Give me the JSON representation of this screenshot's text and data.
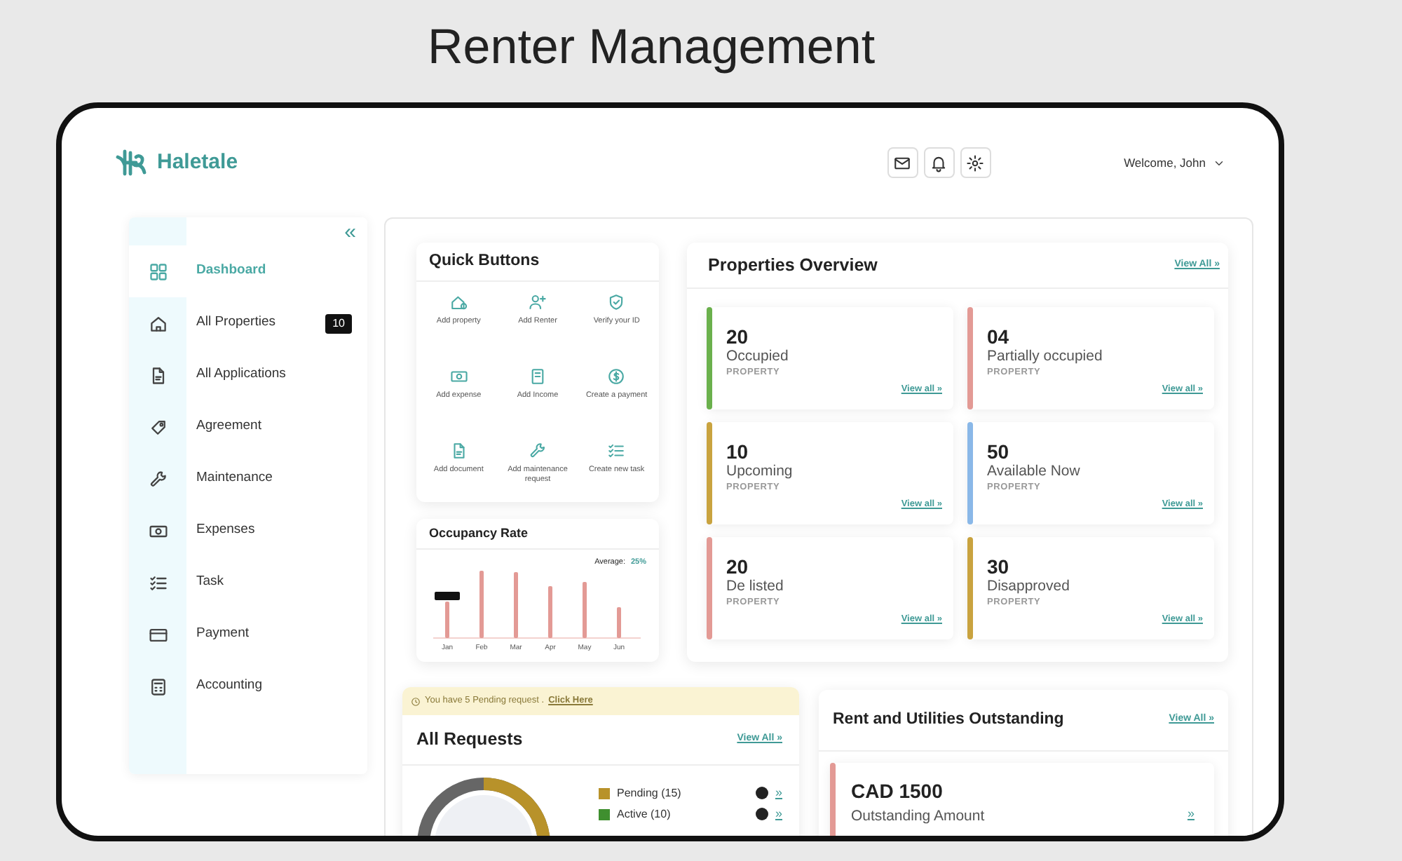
{
  "slide_title": "Renter Management",
  "header": {
    "logo": "Haletale",
    "welcome": "Welcome, John"
  },
  "sidebar": {
    "collapse": "«",
    "items": [
      {
        "label": "Dashboard",
        "selected": true
      },
      {
        "label": "All Properties",
        "selected": false,
        "badge": "10"
      },
      {
        "label": "All Applications",
        "selected": false
      },
      {
        "label": "Agreement",
        "selected": false
      },
      {
        "label": "Maintenance",
        "selected": false
      },
      {
        "label": "Expenses",
        "selected": false
      },
      {
        "label": "Task",
        "selected": false
      },
      {
        "label": "Payment",
        "selected": false
      },
      {
        "label": "Accounting",
        "selected": false
      }
    ]
  },
  "quick_buttons": {
    "title": "Quick Buttons",
    "items": [
      "Add property",
      "Add Renter",
      "Verify your ID",
      "Add expense",
      "Add Income",
      "Create a payment",
      "Add document",
      "Add maintenance request",
      "Create new task"
    ]
  },
  "occupancy": {
    "title": "Occupancy Rate",
    "average_label": "Average:",
    "average_value": "25%",
    "months": [
      "Jan",
      "Feb",
      "Mar",
      "Apr",
      "May",
      "Jun"
    ]
  },
  "properties": {
    "title": "Properties Overview",
    "view_all": "View All »",
    "stats": [
      {
        "value": "20",
        "label": "Occupied",
        "sub": "PROPERTY",
        "link": "View all »",
        "color": "#6ab04c"
      },
      {
        "value": "04",
        "label": "Partially occupied",
        "sub": "PROPERTY",
        "link": "View all »",
        "color": "#e39a95"
      },
      {
        "value": "10",
        "label": "Upcoming",
        "sub": "PROPERTY",
        "link": "View all »",
        "color": "#c9a33f"
      },
      {
        "value": "50",
        "label": "Available Now",
        "sub": "PROPERTY",
        "link": "View all »",
        "color": "#8ab8e8"
      },
      {
        "value": "20",
        "label": "De listed",
        "sub": "PROPERTY",
        "link": "View all »",
        "color": "#e39a95"
      },
      {
        "value": "30",
        "label": "Disapproved",
        "sub": "PROPERTY",
        "link": "View all »",
        "color": "#c9a33f"
      }
    ]
  },
  "requests": {
    "banner": "You have 5 Pending request .",
    "banner_link": "Click Here",
    "title": "All Requests",
    "view_all": "View All »",
    "legend": [
      {
        "label": "Pending (15)",
        "color": "#b8922a",
        "link": "»"
      },
      {
        "label": "Active (10)",
        "color": "#3f8f2f",
        "link": "»"
      }
    ]
  },
  "rent": {
    "title": "Rent and Utilities Outstanding",
    "view_all": "View All »",
    "item": {
      "amount": "CAD 1500",
      "label": "Outstanding Amount",
      "link": "»",
      "color": "#e39a95"
    }
  }
}
